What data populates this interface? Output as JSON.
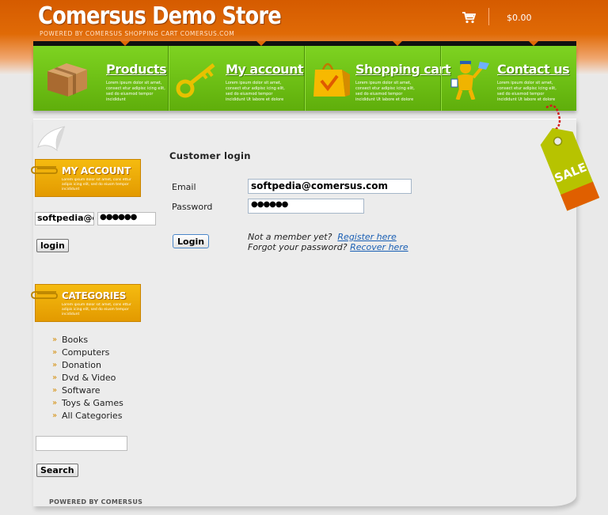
{
  "header": {
    "title": "Comersus Demo Store",
    "subtitle": "POWERED BY COMERSUS SHOPPING CART COMERSUS.COM",
    "cart_total": "$0.00",
    "cart_icon": "shopping-cart-icon"
  },
  "nav": {
    "items": [
      {
        "label": "Products",
        "icon": "package-icon",
        "desc": "Lorem ipsum dolor sit amet, consect etur adipisc icing elit, sed do eiusmod tempor incididunt"
      },
      {
        "label": "My account",
        "icon": "key-icon",
        "desc": "Lorem ipsum dolor sit amet, consect etur adipisc icing elit, sed do eiusmod tempor incididunt Ut labore et dolore magnaaliq"
      },
      {
        "label": "Shopping cart",
        "icon": "shopping-bag-icon",
        "desc": "Lorem ipsum dolor sit amet, consect etur adipisc icing elit, sed do eiusmod tempor incididunt Ut labore et dolore magnaaliq"
      },
      {
        "label": "Contact us",
        "icon": "mail-person-icon",
        "desc": "Lorem ipsum dolor sit amet, consect etur adipisc icing elit, sed do eiusmod tempor incididunt Ut labore et dolore magnaaliq"
      }
    ]
  },
  "sidebar": {
    "account": {
      "title": "MY ACCOUNT",
      "desc": "Lorem ipsum dolor sit amet, cons ettur adipis icing elit, sed do eiusm tempor incididunt",
      "email_value": "softpedia@comersus.com",
      "password_value": "●●●●●●",
      "login_label": "login"
    },
    "categories": {
      "title": "CATEGORIES",
      "desc": "Lorem ipsum dolor sit amet, cons ettur adipis icing elit, sed do eiusm tempor incididunt",
      "items": [
        "Books",
        "Computers",
        "Donation",
        "Dvd & Video",
        "Software",
        "Toys & Games",
        "All Categories"
      ]
    },
    "search": {
      "value": "",
      "button_label": "Search"
    },
    "powered": "POWERED BY COMERSUS"
  },
  "login": {
    "title": "Customer login",
    "email_label": "Email",
    "email_value": "softpedia@comersus.com",
    "password_label": "Password",
    "password_value": "●●●●●●",
    "button_label": "Login",
    "not_member_text": "Not a member yet?",
    "register_link": "Register here",
    "forgot_text": "Forgot your password?",
    "recover_link": "Recover here"
  },
  "sale_tag": "SALE",
  "colors": {
    "header_orange": "#d55b00",
    "nav_green": "#6fc215",
    "banner_yellow": "#f0b10c",
    "link_blue": "#1a5fb4"
  }
}
